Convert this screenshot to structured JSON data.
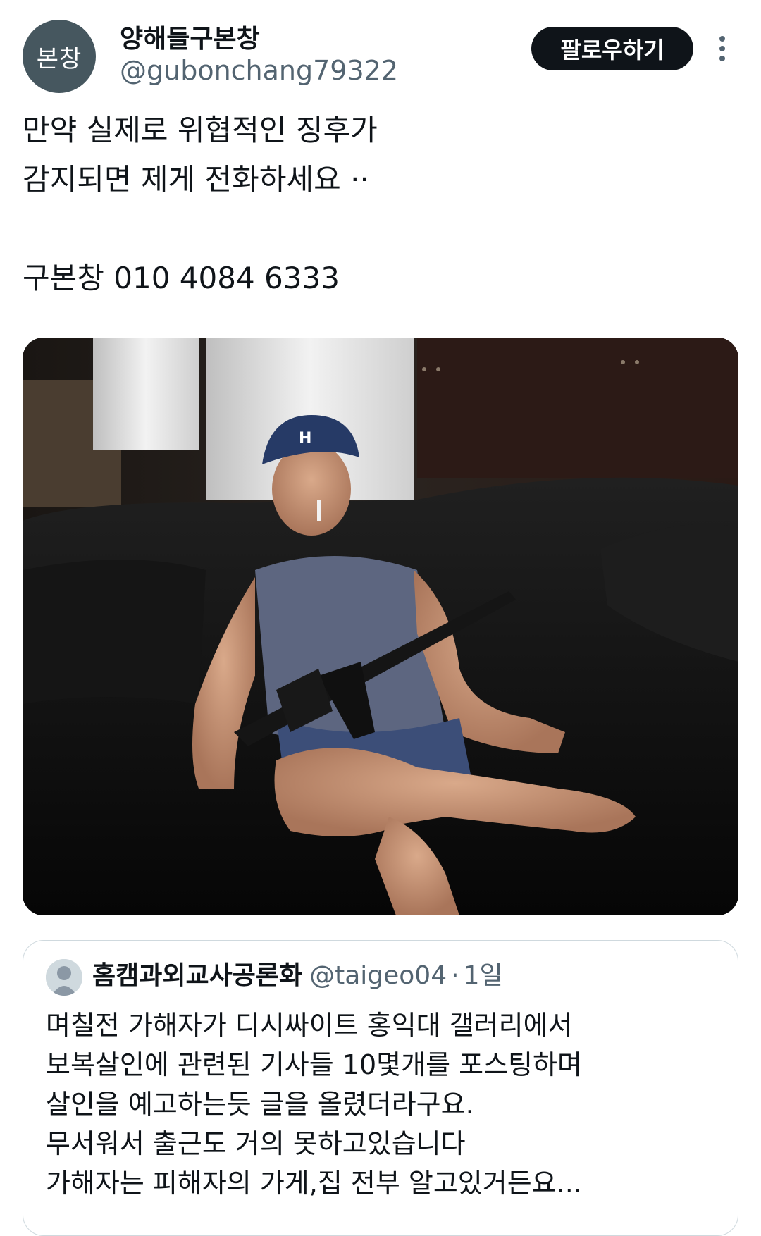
{
  "author": {
    "avatar_text": "본창",
    "display_name": "양해들구본창",
    "handle": "@gubonchang79322"
  },
  "actions": {
    "follow_label": "팔로우하기",
    "more_icon": "more-vertical-icon"
  },
  "tweet": {
    "lines": [
      "만약 실제로 위협적인 징후가",
      "감지되면 제게 전화하세요 ··",
      "구본창 010 4084 6333"
    ]
  },
  "media": {
    "description_icon": "photo"
  },
  "quote": {
    "avatar_icon": "default-profile-icon",
    "display_name": "홈캠과외교사공론화",
    "handle": "@taigeo04",
    "separator": "·",
    "time": "1일",
    "lines": [
      "며칠전 가해자가 디시싸이트 홍익대 갤러리에서",
      "보복살인에 관련된 기사들 10몇개를 포스팅하며",
      "살인을 예고하는듯 글을 올렸더라구요.",
      "무서워서 출근도 거의 못하고있습니다",
      "가해자는 피해자의 가게,집 전부 알고있거든요..."
    ]
  },
  "colors": {
    "text_primary": "#0f1419",
    "text_secondary": "#536471",
    "follow_bg": "#0f1419",
    "avatar_bg": "#46575f",
    "border": "#cfd9de"
  }
}
